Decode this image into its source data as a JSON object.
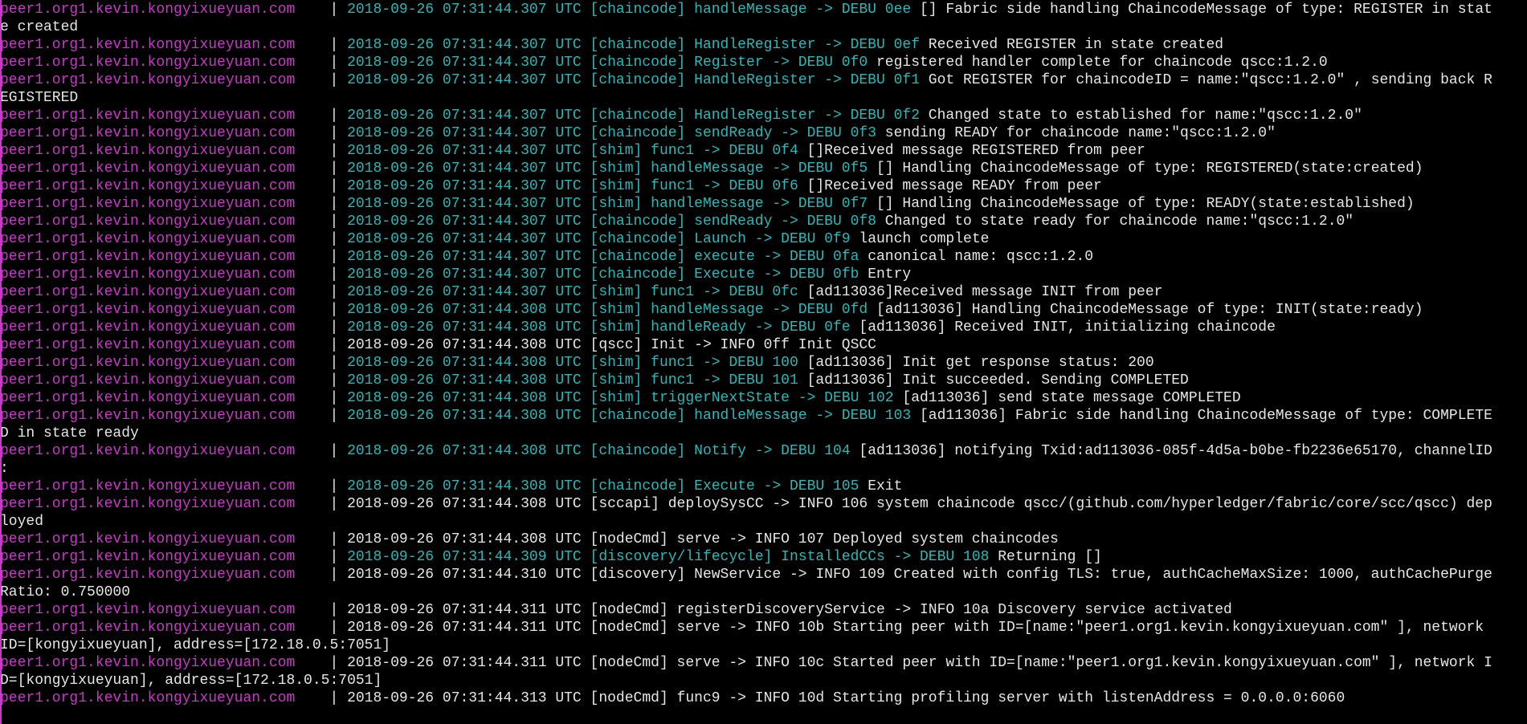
{
  "terminal": {
    "colors": {
      "background": "#000000",
      "service": "#c43cc4",
      "debug": "#2fb7b7",
      "info": "#e6e6e6",
      "cursor": "#18c818"
    },
    "lines": [
      {
        "type": "log",
        "svc": "peer1.org1.kevin.kongyixueyuan.com",
        "sep": "    | ",
        "level": "debu",
        "text": "2018-09-26 07:31:44.307 UTC [chaincode] handleMessage -> DEBU 0ee",
        "tail": " [] Fabric side handling ChaincodeMessage of type: REGISTER in stat"
      },
      {
        "type": "cont",
        "text": "e created"
      },
      {
        "type": "log",
        "svc": "peer1.org1.kevin.kongyixueyuan.com",
        "sep": "    | ",
        "level": "debu",
        "text": "2018-09-26 07:31:44.307 UTC [chaincode] HandleRegister -> DEBU 0ef",
        "tail": " Received REGISTER in state created"
      },
      {
        "type": "log",
        "svc": "peer1.org1.kevin.kongyixueyuan.com",
        "sep": "    | ",
        "level": "debu",
        "text": "2018-09-26 07:31:44.307 UTC [chaincode] Register -> DEBU 0f0",
        "tail": " registered handler complete for chaincode qscc:1.2.0"
      },
      {
        "type": "log",
        "svc": "peer1.org1.kevin.kongyixueyuan.com",
        "sep": "    | ",
        "level": "debu",
        "text": "2018-09-26 07:31:44.307 UTC [chaincode] HandleRegister -> DEBU 0f1",
        "tail": " Got REGISTER for chaincodeID = name:\"qscc:1.2.0\" , sending back R"
      },
      {
        "type": "cont",
        "text": "EGISTERED"
      },
      {
        "type": "log",
        "svc": "peer1.org1.kevin.kongyixueyuan.com",
        "sep": "    | ",
        "level": "debu",
        "text": "2018-09-26 07:31:44.307 UTC [chaincode] HandleRegister -> DEBU 0f2",
        "tail": " Changed state to established for name:\"qscc:1.2.0\""
      },
      {
        "type": "log",
        "svc": "peer1.org1.kevin.kongyixueyuan.com",
        "sep": "    | ",
        "level": "debu",
        "text": "2018-09-26 07:31:44.307 UTC [chaincode] sendReady -> DEBU 0f3",
        "tail": " sending READY for chaincode name:\"qscc:1.2.0\""
      },
      {
        "type": "log",
        "svc": "peer1.org1.kevin.kongyixueyuan.com",
        "sep": "    | ",
        "level": "debu",
        "text": "2018-09-26 07:31:44.307 UTC [shim] func1 -> DEBU 0f4",
        "tail": " []Received message REGISTERED from peer"
      },
      {
        "type": "log",
        "svc": "peer1.org1.kevin.kongyixueyuan.com",
        "sep": "    | ",
        "level": "debu",
        "text": "2018-09-26 07:31:44.307 UTC [shim] handleMessage -> DEBU 0f5",
        "tail": " [] Handling ChaincodeMessage of type: REGISTERED(state:created)"
      },
      {
        "type": "log",
        "svc": "peer1.org1.kevin.kongyixueyuan.com",
        "sep": "    | ",
        "level": "debu",
        "text": "2018-09-26 07:31:44.307 UTC [shim] func1 -> DEBU 0f6",
        "tail": " []Received message READY from peer"
      },
      {
        "type": "log",
        "svc": "peer1.org1.kevin.kongyixueyuan.com",
        "sep": "    | ",
        "level": "debu",
        "text": "2018-09-26 07:31:44.307 UTC [shim] handleMessage -> DEBU 0f7",
        "tail": " [] Handling ChaincodeMessage of type: READY(state:established)"
      },
      {
        "type": "log",
        "svc": "peer1.org1.kevin.kongyixueyuan.com",
        "sep": "    | ",
        "level": "debu",
        "text": "2018-09-26 07:31:44.307 UTC [chaincode] sendReady -> DEBU 0f8",
        "tail": " Changed to state ready for chaincode name:\"qscc:1.2.0\""
      },
      {
        "type": "log",
        "svc": "peer1.org1.kevin.kongyixueyuan.com",
        "sep": "    | ",
        "level": "debu",
        "text": "2018-09-26 07:31:44.307 UTC [chaincode] Launch -> DEBU 0f9",
        "tail": " launch complete"
      },
      {
        "type": "log",
        "svc": "peer1.org1.kevin.kongyixueyuan.com",
        "sep": "    | ",
        "level": "debu",
        "text": "2018-09-26 07:31:44.307 UTC [chaincode] execute -> DEBU 0fa",
        "tail": " canonical name: qscc:1.2.0"
      },
      {
        "type": "log",
        "svc": "peer1.org1.kevin.kongyixueyuan.com",
        "sep": "    | ",
        "level": "debu",
        "text": "2018-09-26 07:31:44.307 UTC [chaincode] Execute -> DEBU 0fb",
        "tail": " Entry"
      },
      {
        "type": "log",
        "svc": "peer1.org1.kevin.kongyixueyuan.com",
        "sep": "    | ",
        "level": "debu",
        "text": "2018-09-26 07:31:44.307 UTC [shim] func1 -> DEBU 0fc",
        "tail": " [ad113036]Received message INIT from peer"
      },
      {
        "type": "log",
        "svc": "peer1.org1.kevin.kongyixueyuan.com",
        "sep": "    | ",
        "level": "debu",
        "text": "2018-09-26 07:31:44.308 UTC [shim] handleMessage -> DEBU 0fd",
        "tail": " [ad113036] Handling ChaincodeMessage of type: INIT(state:ready)"
      },
      {
        "type": "log",
        "svc": "peer1.org1.kevin.kongyixueyuan.com",
        "sep": "    | ",
        "level": "debu",
        "text": "2018-09-26 07:31:44.308 UTC [shim] handleReady -> DEBU 0fe",
        "tail": " [ad113036] Received INIT, initializing chaincode"
      },
      {
        "type": "log",
        "svc": "peer1.org1.kevin.kongyixueyuan.com",
        "sep": "    | ",
        "level": "info",
        "text": "2018-09-26 07:31:44.308 UTC [qscc] Init -> INFO 0ff Init QSCC",
        "tail": ""
      },
      {
        "type": "log",
        "svc": "peer1.org1.kevin.kongyixueyuan.com",
        "sep": "    | ",
        "level": "debu",
        "text": "2018-09-26 07:31:44.308 UTC [shim] func1 -> DEBU 100",
        "tail": " [ad113036] Init get response status: 200"
      },
      {
        "type": "log",
        "svc": "peer1.org1.kevin.kongyixueyuan.com",
        "sep": "    | ",
        "level": "debu",
        "text": "2018-09-26 07:31:44.308 UTC [shim] func1 -> DEBU 101",
        "tail": " [ad113036] Init succeeded. Sending COMPLETED"
      },
      {
        "type": "log",
        "svc": "peer1.org1.kevin.kongyixueyuan.com",
        "sep": "    | ",
        "level": "debu",
        "text": "2018-09-26 07:31:44.308 UTC [shim] triggerNextState -> DEBU 102",
        "tail": " [ad113036] send state message COMPLETED"
      },
      {
        "type": "log",
        "svc": "peer1.org1.kevin.kongyixueyuan.com",
        "sep": "    | ",
        "level": "debu",
        "text": "2018-09-26 07:31:44.308 UTC [chaincode] handleMessage -> DEBU 103",
        "tail": " [ad113036] Fabric side handling ChaincodeMessage of type: COMPLETE"
      },
      {
        "type": "cont",
        "text": "D in state ready"
      },
      {
        "type": "log",
        "svc": "peer1.org1.kevin.kongyixueyuan.com",
        "sep": "    | ",
        "level": "debu",
        "text": "2018-09-26 07:31:44.308 UTC [chaincode] Notify -> DEBU 104",
        "tail": " [ad113036] notifying Txid:ad113036-085f-4d5a-b0be-fb2236e65170, channelID"
      },
      {
        "type": "cont",
        "text": ":"
      },
      {
        "type": "log",
        "svc": "peer1.org1.kevin.kongyixueyuan.com",
        "sep": "    | ",
        "level": "debu",
        "text": "2018-09-26 07:31:44.308 UTC [chaincode] Execute -> DEBU 105",
        "tail": " Exit"
      },
      {
        "type": "log",
        "svc": "peer1.org1.kevin.kongyixueyuan.com",
        "sep": "    | ",
        "level": "info",
        "text": "2018-09-26 07:31:44.308 UTC [sccapi] deploySysCC -> INFO 106 system chaincode qscc/(github.com/hyperledger/fabric/core/scc/qscc) dep",
        "tail": ""
      },
      {
        "type": "cont",
        "text": "loyed"
      },
      {
        "type": "log",
        "svc": "peer1.org1.kevin.kongyixueyuan.com",
        "sep": "    | ",
        "level": "info",
        "text": "2018-09-26 07:31:44.308 UTC [nodeCmd] serve -> INFO 107 Deployed system chaincodes",
        "tail": ""
      },
      {
        "type": "log",
        "svc": "peer1.org1.kevin.kongyixueyuan.com",
        "sep": "    | ",
        "level": "debu",
        "text": "2018-09-26 07:31:44.309 UTC [discovery/lifecycle] InstalledCCs -> DEBU 108",
        "tail": " Returning []"
      },
      {
        "type": "log",
        "svc": "peer1.org1.kevin.kongyixueyuan.com",
        "sep": "    | ",
        "level": "info",
        "text": "2018-09-26 07:31:44.310 UTC [discovery] NewService -> INFO 109 Created with config TLS: true, authCacheMaxSize: 1000, authCachePurge",
        "tail": ""
      },
      {
        "type": "cont",
        "text": "Ratio: 0.750000"
      },
      {
        "type": "log",
        "svc": "peer1.org1.kevin.kongyixueyuan.com",
        "sep": "    | ",
        "level": "info",
        "text": "2018-09-26 07:31:44.311 UTC [nodeCmd] registerDiscoveryService -> INFO 10a Discovery service activated",
        "tail": ""
      },
      {
        "type": "log",
        "svc": "peer1.org1.kevin.kongyixueyuan.com",
        "sep": "    | ",
        "level": "info",
        "text": "2018-09-26 07:31:44.311 UTC [nodeCmd] serve -> INFO 10b Starting peer with ID=[name:\"peer1.org1.kevin.kongyixueyuan.com\" ], network",
        "tail": ""
      },
      {
        "type": "cont",
        "text": "ID=[kongyixueyuan], address=[172.18.0.5:7051]"
      },
      {
        "type": "log",
        "svc": "peer1.org1.kevin.kongyixueyuan.com",
        "sep": "    | ",
        "level": "info",
        "text": "2018-09-26 07:31:44.311 UTC [nodeCmd] serve -> INFO 10c Started peer with ID=[name:\"peer1.org1.kevin.kongyixueyuan.com\" ], network I",
        "tail": ""
      },
      {
        "type": "cont",
        "text": "D=[kongyixueyuan], address=[172.18.0.5:7051]"
      },
      {
        "type": "log",
        "svc": "peer1.org1.kevin.kongyixueyuan.com",
        "sep": "    | ",
        "level": "info",
        "text": "2018-09-26 07:31:44.313 UTC [nodeCmd] func9 -> INFO 10d Starting profiling server with listenAddress = 0.0.0.0:6060",
        "tail": ""
      }
    ]
  }
}
